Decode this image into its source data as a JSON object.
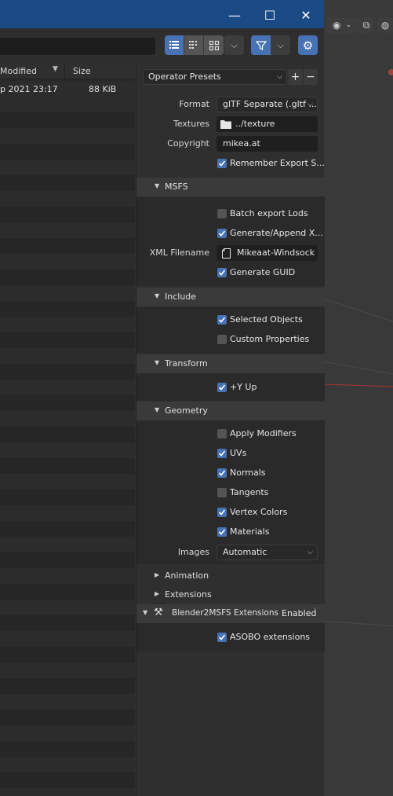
{
  "window": {
    "titlebar": {
      "minimize": "—",
      "maximize": "☐",
      "close": "✕"
    }
  },
  "filelist": {
    "col_modified": "Modified",
    "col_size": "Size",
    "rows": [
      {
        "modified": "p 2021 23:17",
        "size": "88 KiB"
      }
    ]
  },
  "panel": {
    "operator_presets": "Operator Presets",
    "format_label": "Format",
    "format_value": "glTF Separate (.gltf ...",
    "textures_label": "Textures",
    "textures_value": "../texture",
    "copyright_label": "Copyright",
    "copyright_value": "mikea.at",
    "remember_export": "Remember Export S...",
    "msfs": {
      "title": "MSFS",
      "batch_export": "Batch export Lods",
      "generate_append": "Generate/Append X...",
      "xml_label": "XML Filename",
      "xml_value": "Mikeaat-Windsock",
      "generate_guid": "Generate GUID"
    },
    "include": {
      "title": "Include",
      "selected_objects": "Selected Objects",
      "custom_properties": "Custom Properties"
    },
    "transform": {
      "title": "Transform",
      "y_up": "+Y Up"
    },
    "geometry": {
      "title": "Geometry",
      "apply_modifiers": "Apply Modifiers",
      "uvs": "UVs",
      "normals": "Normals",
      "tangents": "Tangents",
      "vertex_colors": "Vertex Colors",
      "materials": "Materials",
      "images_label": "Images",
      "images_value": "Automatic"
    },
    "animation": {
      "title": "Animation"
    },
    "extensions": {
      "title": "Extensions"
    },
    "b2msfs": {
      "title": "Blender2MSFS Extensions",
      "enabled": "Enabled",
      "asobo": "ASOBO extensions"
    }
  },
  "colors": {
    "accent": "#4772b3",
    "titlebar": "#1a4a86",
    "panel_bg": "#2f2f2f"
  }
}
